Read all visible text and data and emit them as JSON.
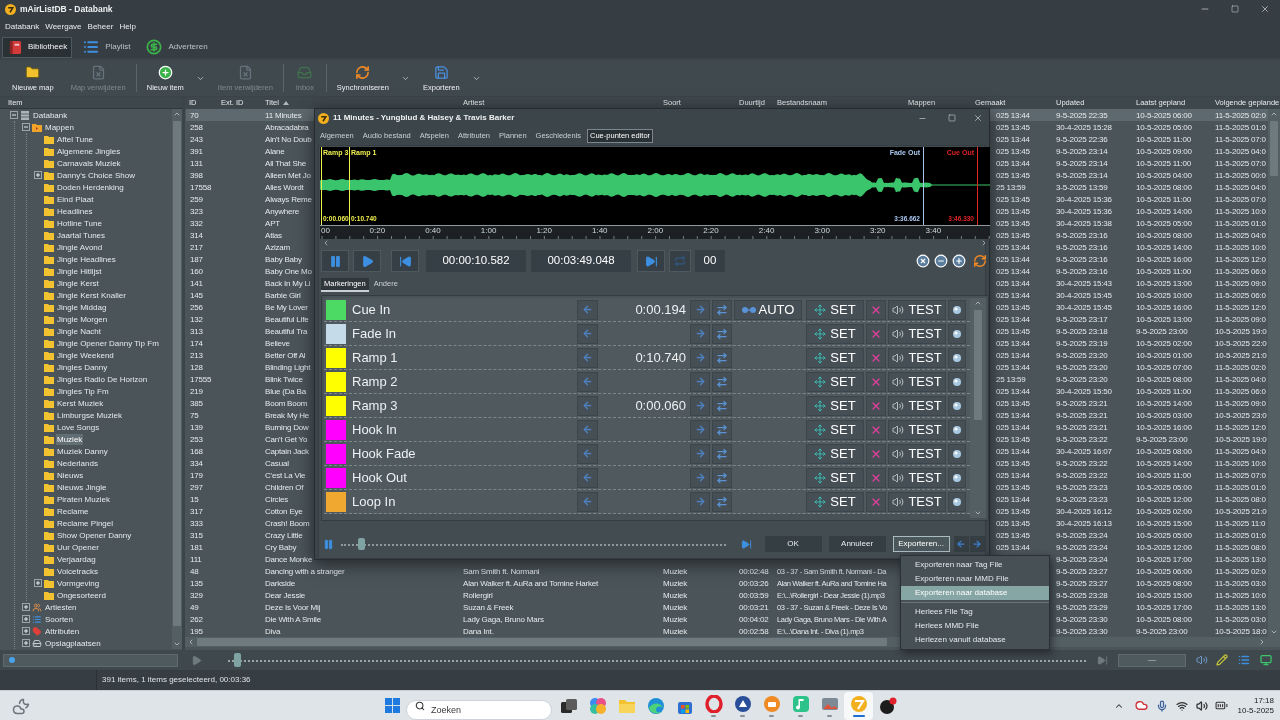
{
  "window": {
    "title": "mAirListDB - Databank"
  },
  "menu": [
    "Databank",
    "Weergave",
    "Beheer",
    "Help"
  ],
  "modules": [
    {
      "label": "Bibliotheek",
      "selected": true
    },
    {
      "label": "Playlist",
      "selected": false
    },
    {
      "label": "Adverteren",
      "selected": false
    }
  ],
  "toolbar": {
    "groups": [
      {
        "buttons": [
          {
            "label": "Nieuwe map",
            "disabled": false,
            "dropdown": false
          },
          {
            "label": "Map verwijderen",
            "disabled": true,
            "dropdown": false
          }
        ]
      },
      {
        "buttons": [
          {
            "label": "Nieuw item",
            "disabled": false,
            "dropdown": true
          },
          {
            "label": "Item verwijderen",
            "disabled": true,
            "dropdown": false
          }
        ]
      },
      {
        "buttons": [
          {
            "label": "Inbox",
            "disabled": true,
            "dropdown": false
          }
        ]
      },
      {
        "buttons": [
          {
            "label": "Synchroniseren",
            "disabled": false,
            "dropdown": true
          },
          {
            "label": "Exporteren",
            "disabled": false,
            "dropdown": true
          }
        ]
      }
    ]
  },
  "tree": {
    "header": "Item",
    "items": [
      {
        "label": "Databank",
        "kind": "database",
        "selected": false,
        "expanded": true,
        "children": [
          {
            "label": "Mappen",
            "kind": "folders",
            "selected": false,
            "expanded": true,
            "children": [
              {
                "label": "Aftel Tune",
                "kind": "folder",
                "selected": false
              },
              {
                "label": "Algemene Jingles",
                "kind": "folder",
                "selected": false
              },
              {
                "label": "Carnavals Muziek",
                "kind": "folder",
                "selected": false
              },
              {
                "label": "Danny's Choice Show",
                "kind": "folder",
                "selected": false,
                "expanded": false
              },
              {
                "label": "Doden Herdenking",
                "kind": "folder",
                "selected": false
              },
              {
                "label": "Eind Plaat",
                "kind": "folder",
                "selected": false
              },
              {
                "label": "Headlines",
                "kind": "folder",
                "selected": false
              },
              {
                "label": "Hotline Tune",
                "kind": "folder",
                "selected": false
              },
              {
                "label": "Jaartal Tunes",
                "kind": "folder",
                "selected": false
              },
              {
                "label": "Jingle Avond",
                "kind": "folder",
                "selected": false
              },
              {
                "label": "Jingle Headlines",
                "kind": "folder",
                "selected": false
              },
              {
                "label": "Jingle Hitlijst",
                "kind": "folder",
                "selected": false
              },
              {
                "label": "Jingle Kerst",
                "kind": "folder",
                "selected": false
              },
              {
                "label": "Jingle Kerst Knaller",
                "kind": "folder",
                "selected": false
              },
              {
                "label": "Jingle Middag",
                "kind": "folder",
                "selected": false
              },
              {
                "label": "Jingle Morgen",
                "kind": "folder",
                "selected": false
              },
              {
                "label": "Jingle Nacht",
                "kind": "folder",
                "selected": false
              },
              {
                "label": "Jingle Opener Danny Tip Fm",
                "kind": "folder",
                "selected": false
              },
              {
                "label": "Jingle Weekend",
                "kind": "folder",
                "selected": false
              },
              {
                "label": "Jingles Danny",
                "kind": "folder",
                "selected": false
              },
              {
                "label": "Jingles Radio De Horizon",
                "kind": "folder",
                "selected": false
              },
              {
                "label": "Jingles Tip Fm",
                "kind": "folder",
                "selected": false
              },
              {
                "label": "Kerst Muziek",
                "kind": "folder",
                "selected": false
              },
              {
                "label": "Limburgse Muziek",
                "kind": "folder",
                "selected": false
              },
              {
                "label": "Love Songs",
                "kind": "folder",
                "selected": false
              },
              {
                "label": "Muziek",
                "kind": "folder",
                "selected": true
              },
              {
                "label": "Muziek Danny",
                "kind": "folder",
                "selected": false
              },
              {
                "label": "Nederlands",
                "kind": "folder",
                "selected": false
              },
              {
                "label": "Nieuws",
                "kind": "folder",
                "selected": false
              },
              {
                "label": "Nieuws Jingle",
                "kind": "folder",
                "selected": false
              },
              {
                "label": "Piraten Muziek",
                "kind": "folder",
                "selected": false
              },
              {
                "label": "Reclame",
                "kind": "folder",
                "selected": false
              },
              {
                "label": "Reclame Pingel",
                "kind": "folder",
                "selected": false
              },
              {
                "label": "Show Opener Danny",
                "kind": "folder",
                "selected": false
              },
              {
                "label": "Uur Opener",
                "kind": "folder",
                "selected": false
              },
              {
                "label": "Verjaardag",
                "kind": "folder",
                "selected": false
              },
              {
                "label": "Voicetracks",
                "kind": "folder",
                "selected": false
              },
              {
                "label": "Vormgeving",
                "kind": "folder",
                "selected": false,
                "expanded": false
              },
              {
                "label": "Ongesorteerd",
                "kind": "folder",
                "selected": false
              }
            ]
          },
          {
            "label": "Artiesten",
            "kind": "artists",
            "selected": false,
            "expanded": false
          },
          {
            "label": "Soorten",
            "kind": "types",
            "selected": false,
            "expanded": false
          },
          {
            "label": "Attributen",
            "kind": "attributes",
            "selected": false,
            "expanded": false
          },
          {
            "label": "Opslagplaatsen",
            "kind": "storage",
            "selected": false,
            "expanded": false
          }
        ]
      }
    ]
  },
  "table": {
    "columns": [
      {
        "label": "ID",
        "sorted": false
      },
      {
        "label": "Ext. ID",
        "sorted": false
      },
      {
        "label": "Titel",
        "sorted": true
      },
      {
        "label": "Artiest",
        "sorted": false
      },
      {
        "label": "Soort",
        "sorted": false
      },
      {
        "label": "Duurtijd",
        "sorted": false
      },
      {
        "label": "Bestandsnaam",
        "sorted": false
      },
      {
        "label": "Mappen",
        "sorted": false
      },
      {
        "label": "Gemaakt",
        "sorted": false
      },
      {
        "label": "Updated",
        "sorted": false
      },
      {
        "label": "Laatst gepland",
        "sorted": false
      },
      {
        "label": "Volgende geplande",
        "sorted": false
      }
    ],
    "rows": [
      {
        "id": "70",
        "title": "11 Minutes",
        "created": "025 13:44",
        "updated": "9-5-2025 22:35",
        "last_planned": "10-5-2025 06:00",
        "next_planned": "11-5-2025 02:0",
        "selected": true
      },
      {
        "id": "258",
        "title": "Abracadabra",
        "created": "025 13:45",
        "updated": "30-4-2025 15:28",
        "last_planned": "10-5-2025 05:00",
        "next_planned": "11-5-2025 01:0",
        "selected": false
      },
      {
        "id": "243",
        "title": "Ain't No Doub",
        "created": "025 13:44",
        "updated": "9-5-2025 22:36",
        "last_planned": "10-5-2025 11:00",
        "next_planned": "11-5-2025 07:0",
        "selected": false
      },
      {
        "id": "391",
        "title": "Alane",
        "created": "025 13:45",
        "updated": "9-5-2025 23:14",
        "last_planned": "10-5-2025 09:00",
        "next_planned": "11-5-2025 04:0",
        "selected": false
      },
      {
        "id": "131",
        "title": "All That She",
        "created": "025 13:44",
        "updated": "9-5-2025 23:14",
        "last_planned": "10-5-2025 11:00",
        "next_planned": "11-5-2025 07:0",
        "selected": false
      },
      {
        "id": "398",
        "title": "Alleen Met Jo",
        "created": "025 13:45",
        "updated": "9-5-2025 23:14",
        "last_planned": "10-5-2025 04:00",
        "next_planned": "11-5-2025 00:0",
        "selected": false
      },
      {
        "id": "17558",
        "title": "Alles Wordt",
        "created": "25 13:59",
        "updated": "3-5-2025 13:59",
        "last_planned": "10-5-2025 08:00",
        "next_planned": "11-5-2025 04:0",
        "selected": false
      },
      {
        "id": "259",
        "title": "Always Reme",
        "created": "025 13:45",
        "updated": "30-4-2025 15:36",
        "last_planned": "10-5-2025 11:00",
        "next_planned": "11-5-2025 07:0",
        "selected": false
      },
      {
        "id": "323",
        "title": "Anywhere",
        "created": "025 13:45",
        "updated": "30-4-2025 15:36",
        "last_planned": "10-5-2025 14:00",
        "next_planned": "11-5-2025 10:0",
        "selected": false
      },
      {
        "id": "332",
        "title": "APT",
        "created": "025 13:45",
        "updated": "30-4-2025 15:38",
        "last_planned": "10-5-2025 05:00",
        "next_planned": "11-5-2025 01:0",
        "selected": false
      },
      {
        "id": "314",
        "title": "Atlas",
        "created": "025 13:45",
        "updated": "9-5-2025 23:16",
        "last_planned": "10-5-2025 08:00",
        "next_planned": "11-5-2025 04:0",
        "selected": false
      },
      {
        "id": "217",
        "title": "Azizam",
        "created": "025 13:44",
        "updated": "9-5-2025 23:16",
        "last_planned": "10-5-2025 14:00",
        "next_planned": "11-5-2025 10:0",
        "selected": false
      },
      {
        "id": "187",
        "title": "Baby Baby",
        "created": "025 13:44",
        "updated": "9-5-2025 23:16",
        "last_planned": "10-5-2025 16:00",
        "next_planned": "11-5-2025 12:0",
        "selected": false
      },
      {
        "id": "160",
        "title": "Baby One Mo",
        "created": "025 13:44",
        "updated": "9-5-2025 23:16",
        "last_planned": "10-5-2025 11:00",
        "next_planned": "11-5-2025 06:0",
        "selected": false
      },
      {
        "id": "141",
        "title": "Back In My Li",
        "created": "025 13:44",
        "updated": "30-4-2025 15:43",
        "last_planned": "10-5-2025 13:00",
        "next_planned": "11-5-2025 09:0",
        "selected": false
      },
      {
        "id": "145",
        "title": "Barbie Girl",
        "created": "025 13:44",
        "updated": "30-4-2025 15:45",
        "last_planned": "10-5-2025 10:00",
        "next_planned": "11-5-2025 06:0",
        "selected": false
      },
      {
        "id": "256",
        "title": "Be My Lover",
        "created": "025 13:45",
        "updated": "30-4-2025 15:45",
        "last_planned": "10-5-2025 16:00",
        "next_planned": "11-5-2025 12:0",
        "selected": false
      },
      {
        "id": "132",
        "title": "Beautiful Life",
        "created": "025 13:44",
        "updated": "9-5-2025 23:17",
        "last_planned": "10-5-2025 13:00",
        "next_planned": "11-5-2025 09:0",
        "selected": false
      },
      {
        "id": "313",
        "title": "Beautiful Tra",
        "created": "025 13:45",
        "updated": "9-5-2025 23:18",
        "last_planned": "9-5-2025 23:00",
        "next_planned": "10-5-2025 19:0",
        "selected": false
      },
      {
        "id": "174",
        "title": "Believe",
        "created": "025 13:44",
        "updated": "9-5-2025 23:19",
        "last_planned": "10-5-2025 02:00",
        "next_planned": "10-5-2025 22:0",
        "selected": false
      },
      {
        "id": "213",
        "title": "Better Off Al",
        "created": "025 13:44",
        "updated": "9-5-2025 23:20",
        "last_planned": "10-5-2025 01:00",
        "next_planned": "10-5-2025 21:0",
        "selected": false
      },
      {
        "id": "128",
        "title": "Blinding Light",
        "created": "025 13:44",
        "updated": "9-5-2025 23:20",
        "last_planned": "10-5-2025 07:00",
        "next_planned": "11-5-2025 02:0",
        "selected": false
      },
      {
        "id": "17555",
        "title": "Blink Twice",
        "created": "25 13:59",
        "updated": "9-5-2025 23:20",
        "last_planned": "10-5-2025 08:00",
        "next_planned": "11-5-2025 04:0",
        "selected": false
      },
      {
        "id": "219",
        "title": "Blue (Da Ba",
        "created": "025 13:44",
        "updated": "30-4-2025 15:50",
        "last_planned": "10-5-2025 11:00",
        "next_planned": "11-5-2025 06:0",
        "selected": false
      },
      {
        "id": "385",
        "title": "Boom Boom",
        "created": "025 13:45",
        "updated": "9-5-2025 23:21",
        "last_planned": "10-5-2025 14:00",
        "next_planned": "11-5-2025 09:0",
        "selected": false
      },
      {
        "id": "75",
        "title": "Break My He",
        "created": "025 13:44",
        "updated": "9-5-2025 23:21",
        "last_planned": "10-5-2025 03:00",
        "next_planned": "10-5-2025 23:0",
        "selected": false
      },
      {
        "id": "139",
        "title": "Burning Dow",
        "created": "025 13:44",
        "updated": "9-5-2025 23:21",
        "last_planned": "10-5-2025 16:00",
        "next_planned": "11-5-2025 12:0",
        "selected": false
      },
      {
        "id": "253",
        "title": "Can't Get Yo",
        "created": "025 13:45",
        "updated": "9-5-2025 23:22",
        "last_planned": "9-5-2025 23:00",
        "next_planned": "10-5-2025 19:0",
        "selected": false
      },
      {
        "id": "168",
        "title": "Captain Jack",
        "created": "025 13:44",
        "updated": "30-4-2025 16:07",
        "last_planned": "10-5-2025 08:00",
        "next_planned": "11-5-2025 04:0",
        "selected": false
      },
      {
        "id": "334",
        "title": "Casual",
        "created": "025 13:45",
        "updated": "9-5-2025 23:22",
        "last_planned": "10-5-2025 14:00",
        "next_planned": "11-5-2025 10:0",
        "selected": false
      },
      {
        "id": "179",
        "title": "C'est La Vie",
        "created": "025 13:44",
        "updated": "9-5-2025 23:22",
        "last_planned": "10-5-2025 11:00",
        "next_planned": "11-5-2025 07:0",
        "selected": false
      },
      {
        "id": "297",
        "title": "Children Of",
        "created": "025 13:45",
        "updated": "9-5-2025 23:23",
        "last_planned": "10-5-2025 05:00",
        "next_planned": "11-5-2025 01:0",
        "selected": false
      },
      {
        "id": "15",
        "title": "Circles",
        "created": "025 13:44",
        "updated": "9-5-2025 23:23",
        "last_planned": "10-5-2025 12:00",
        "next_planned": "11-5-2025 08:0",
        "selected": false
      },
      {
        "id": "317",
        "title": "Cotton Eye",
        "created": "025 13:45",
        "updated": "30-4-2025 16:12",
        "last_planned": "10-5-2025 02:00",
        "next_planned": "10-5-2025 21:0",
        "selected": false
      },
      {
        "id": "333",
        "title": "Crash! Boom",
        "created": "025 13:45",
        "updated": "30-4-2025 16:13",
        "last_planned": "10-5-2025 15:00",
        "next_planned": "11-5-2025 11:0",
        "selected": false
      },
      {
        "id": "315",
        "title": "Crazy Little",
        "created": "025 13:45",
        "updated": "9-5-2025 23:24",
        "last_planned": "10-5-2025 05:00",
        "next_planned": "11-5-2025 01:0",
        "selected": false
      },
      {
        "id": "181",
        "title": "Cry Baby",
        "created": "025 13:44",
        "updated": "9-5-2025 23:24",
        "last_planned": "10-5-2025 12:00",
        "next_planned": "11-5-2025 08:0",
        "selected": false
      },
      {
        "id": "111",
        "title": "Dance Monke",
        "updated": "9-5-2025 23:24",
        "last_planned": "10-5-2025 17:00",
        "next_planned": "11-5-2025 13:0",
        "selected": false
      },
      {
        "id": "48",
        "title": "Dancing with a stranger",
        "artist": "Sam Smith ft. Normani",
        "type": "Muziek",
        "duration": "00:02:48",
        "filename": "03 - 37 - Sam Smith ft. Normani - Da",
        "updated": "9-5-2025 23:27",
        "last_planned": "10-5-2025 06:00",
        "next_planned": "11-5-2025 02:0",
        "selected": false
      },
      {
        "id": "135",
        "title": "Darkside",
        "artist": "Alan Walker ft. AuRa and Tomine Harket",
        "type": "Muziek",
        "duration": "00:03:26",
        "filename": "Alan Walker ft. AuRa and Tomine Ha",
        "updated": "9-5-2025 23:27",
        "last_planned": "10-5-2025 08:00",
        "next_planned": "11-5-2025 03:0",
        "selected": false
      },
      {
        "id": "329",
        "title": "Dear Jessie",
        "artist": "Rollergirl",
        "type": "Muziek",
        "duration": "00:03:59",
        "filename": "E:\\...\\Rollergirl - Dear Jessie (1).mp3",
        "updated": "9-5-2025 23:28",
        "last_planned": "10-5-2025 15:00",
        "next_planned": "11-5-2025 10:0",
        "selected": false
      },
      {
        "id": "49",
        "title": "Deze Is Voor Mij",
        "artist": "Suzan & Freek",
        "type": "Muziek",
        "duration": "00:03:21",
        "filename": "03 - 37 - Suzan & Freek - Deze Is Vo",
        "updated": "9-5-2025 23:29",
        "last_planned": "10-5-2025 17:00",
        "next_planned": "11-5-2025 13:0",
        "selected": false
      },
      {
        "id": "262",
        "title": "Die With A Smile",
        "artist": "Lady Gaga, Bruno Mars",
        "type": "Muziek",
        "duration": "00:04:02",
        "filename": "Lady Gaga, Bruno Mars - Die With A",
        "updated": "9-5-2025 23:30",
        "last_planned": "10-5-2025 08:00",
        "next_planned": "11-5-2025 03:0",
        "selected": false
      },
      {
        "id": "195",
        "title": "Diva",
        "artist": "Dana Int.",
        "type": "Muziek",
        "duration": "00:02:58",
        "filename": "E:\\...\\Dana Int. - Diva (1).mp3",
        "updated": "9-5-2025 23:30",
        "last_planned": "9-5-2025 23:00",
        "next_planned": "10-5-2025 18:0",
        "selected": false
      }
    ]
  },
  "item_dialog": {
    "title": "11 Minutes - Yungblud & Halsey & Travis Barker",
    "tabs": [
      {
        "label": "Algemeen",
        "selected": false
      },
      {
        "label": "Audio bestand",
        "selected": false
      },
      {
        "label": "Afspelen",
        "selected": false
      },
      {
        "label": "Attributen",
        "selected": false
      },
      {
        "label": "Plannen",
        "selected": false
      },
      {
        "label": "Geschiedenis",
        "selected": false
      },
      {
        "label": "Cue-punten editor",
        "selected": true
      }
    ],
    "waveform": {
      "markers": [
        {
          "label": "Ramp 3",
          "time": "0:00.060",
          "color": "#f0f050"
        },
        {
          "label": "Ramp 1",
          "time": "0:10.740",
          "color": "#f0f050"
        },
        {
          "label": "Fade Out",
          "time": "3:36.662",
          "color": "#a9c6ee"
        },
        {
          "label": "Cue Out",
          "time": "3:46.330",
          "color": "#e02424"
        }
      ],
      "ticks": [
        "00",
        "0:20",
        "0:40",
        "1:00",
        "1:20",
        "1:40",
        "2:00",
        "2:20",
        "2:40",
        "3:00",
        "3:20",
        "3:40"
      ]
    },
    "transport": {
      "position": "00:00:10.582",
      "duration": "00:03:49.048",
      "loop_count": "00",
      "loop": false
    },
    "marker_tabs": [
      {
        "label": "Markeringen",
        "selected": true
      },
      {
        "label": "Andere",
        "selected": false
      }
    ],
    "cue_points": [
      {
        "name": "Cue In",
        "color": "#4cd964",
        "time": "0:00.194",
        "auto_label": "AUTO",
        "set_label": "SET",
        "test_label": "TEST"
      },
      {
        "name": "Fade In",
        "color": "#c5dbe9",
        "set_label": "SET",
        "test_label": "TEST"
      },
      {
        "name": "Ramp 1",
        "color": "#ffff00",
        "time": "0:10.740",
        "set_label": "SET",
        "test_label": "TEST"
      },
      {
        "name": "Ramp 2",
        "color": "#ffff00",
        "set_label": "SET",
        "test_label": "TEST"
      },
      {
        "name": "Ramp 3",
        "color": "#ffff00",
        "time": "0:00.060",
        "set_label": "SET",
        "test_label": "TEST"
      },
      {
        "name": "Hook In",
        "color": "#ff00ff",
        "set_label": "SET",
        "test_label": "TEST"
      },
      {
        "name": "Hook Fade",
        "color": "#ff00ff",
        "set_label": "SET",
        "test_label": "TEST"
      },
      {
        "name": "Hook Out",
        "color": "#ff00ff",
        "set_label": "SET",
        "test_label": "TEST"
      },
      {
        "name": "Loop In",
        "color": "#f0a830",
        "set_label": "SET",
        "test_label": "TEST"
      }
    ],
    "preview": {
      "level": 0.05
    },
    "buttons": [
      {
        "label": "OK",
        "open": false
      },
      {
        "label": "Annuleer",
        "open": false
      },
      {
        "label": "Exporteren...",
        "open": true
      }
    ]
  },
  "export_menu": {
    "groups": [
      {
        "items": [
          {
            "label": "Exporteren naar Tag File",
            "selected": false
          },
          {
            "label": "Exporteren naar MMD File",
            "selected": false
          },
          {
            "label": "Exporteren naar database",
            "selected": true
          }
        ]
      },
      {
        "items": [
          {
            "label": "Herlees File Tag",
            "selected": false
          },
          {
            "label": "Herlees MMD File",
            "selected": false
          },
          {
            "label": "Herlezen vanuit database",
            "selected": false
          }
        ]
      }
    ]
  },
  "player": {
    "level": 0.01,
    "readout": "—"
  },
  "status_bar": {
    "text": "391 items, 1 items geselecteerd, 00:03:36"
  },
  "taskbar": {
    "search_placeholder": "Zoeken",
    "apps": [
      {
        "running": false,
        "active": false
      },
      {
        "running": false,
        "active": false
      },
      {
        "running": false,
        "active": false
      },
      {
        "running": false,
        "active": false
      },
      {
        "running": false,
        "active": false
      },
      {
        "running": true,
        "active": false
      },
      {
        "running": true,
        "active": false
      },
      {
        "running": true,
        "active": false
      },
      {
        "running": true,
        "active": false
      },
      {
        "running": true,
        "active": false
      },
      {
        "running": true,
        "active": true
      },
      {
        "running": false,
        "active": false
      }
    ],
    "time": "17:18",
    "date": "10-5-2025"
  }
}
